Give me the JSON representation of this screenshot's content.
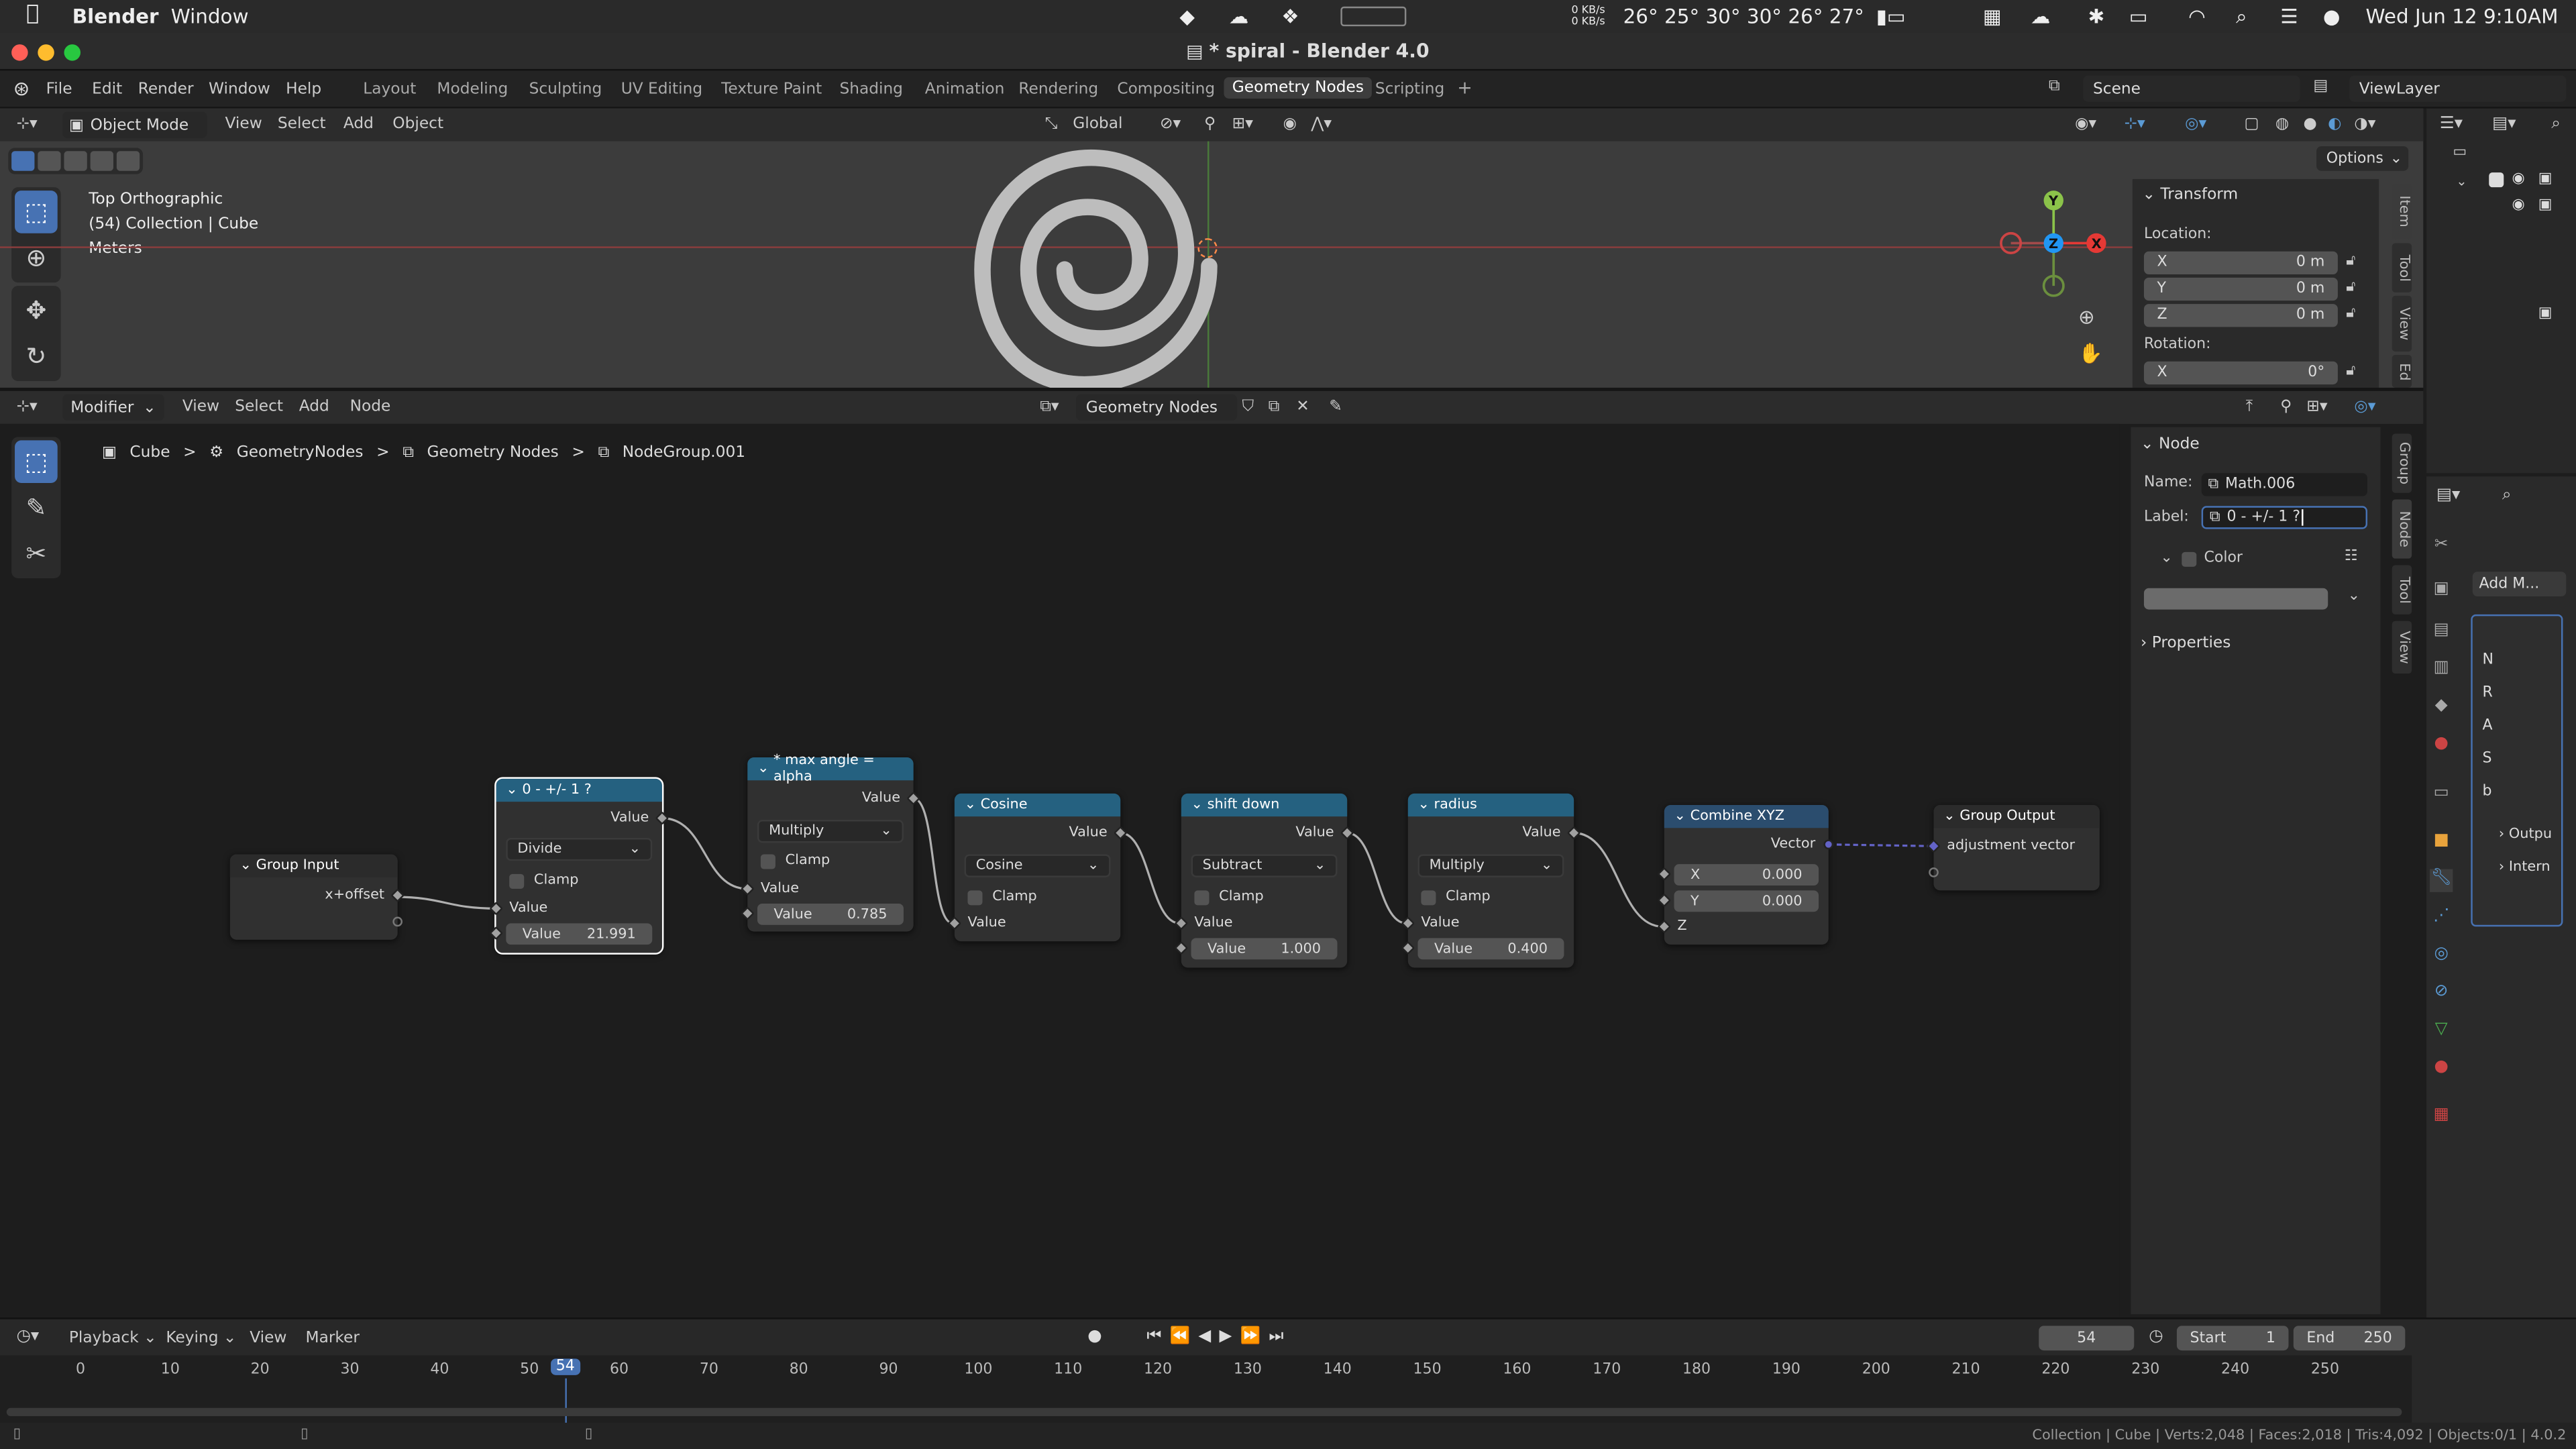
{
  "macos": {
    "apple_icon": "apple-logo",
    "app_name": "Blender",
    "menu": [
      "Window"
    ],
    "net_up": "0 KB/s",
    "net_down": "0 KB/s",
    "temps": "26° 25° 30° 30° 26° 27°",
    "datetime": "Wed Jun 12  9:10AM"
  },
  "window": {
    "title": "* spiral - Blender 4.0"
  },
  "topbar": {
    "menus": [
      "File",
      "Edit",
      "Render",
      "Window",
      "Help"
    ],
    "workspaces": [
      "Layout",
      "Modeling",
      "Sculpting",
      "UV Editing",
      "Texture Paint",
      "Shading",
      "Animation",
      "Rendering",
      "Compositing",
      "Geometry Nodes",
      "Scripting"
    ],
    "active_workspace": "Geometry Nodes",
    "add_tab": "+",
    "scene": "Scene",
    "view_layer": "ViewLayer"
  },
  "viewport": {
    "mode": "Object Mode",
    "menus": [
      "View",
      "Select",
      "Add",
      "Object"
    ],
    "orientation": "Global",
    "options": "Options",
    "overlay_lines": [
      "Top Orthographic",
      "(54) Collection | Cube",
      "Meters"
    ],
    "gizmo": {
      "y": "Y",
      "z": "Z",
      "x": "X"
    },
    "transform_panel": {
      "title": "Transform",
      "location_label": "Location:",
      "x_label": "X",
      "x": "0 m",
      "y_label": "Y",
      "y": "0 m",
      "z_label": "Z",
      "z": "0 m",
      "rotation_label": "Rotation:",
      "rx_label": "X",
      "rx": "0°"
    },
    "side_tabs": [
      "Item",
      "Tool",
      "View",
      "Ed"
    ]
  },
  "node_editor": {
    "editor_type": "Modifier",
    "menus": [
      "View",
      "Select",
      "Add",
      "Node"
    ],
    "node_tree": "Geometry Nodes",
    "breadcrumb": [
      "Cube",
      "GeometryNodes",
      "Geometry Nodes",
      "NodeGroup.001"
    ],
    "breadcrumb_sep": ">",
    "side_tabs": [
      "Group",
      "Node",
      "Tool",
      "View"
    ],
    "node_panel": {
      "title": "Node",
      "name_label": "Name:",
      "name": "Math.006",
      "label_label": "Label:",
      "label": "0 - +/- 1 ?",
      "color_label": "Color",
      "properties_label": "Properties"
    },
    "nodes": {
      "group_input": {
        "title": "Group Input",
        "output": "x+offset"
      },
      "divide": {
        "title": "0 - +/- 1 ?",
        "output": "Value",
        "operation": "Divide",
        "clamp": "Clamp",
        "input": "Value",
        "value_label": "Value",
        "value": "21.991"
      },
      "max_angle": {
        "title": "* max angle = alpha",
        "output": "Value",
        "operation": "Multiply",
        "clamp": "Clamp",
        "input": "Value",
        "value_label": "Value",
        "value": "0.785"
      },
      "cosine": {
        "title": "Cosine",
        "output": "Value",
        "operation": "Cosine",
        "clamp": "Clamp",
        "input": "Value"
      },
      "shift_down": {
        "title": "shift down",
        "output": "Value",
        "operation": "Subtract",
        "clamp": "Clamp",
        "input": "Value",
        "value_label": "Value",
        "value": "1.000"
      },
      "radius": {
        "title": "radius",
        "output": "Value",
        "operation": "Multiply",
        "clamp": "Clamp",
        "input": "Value",
        "value_label": "Value",
        "value": "0.400"
      },
      "combine_xyz": {
        "title": "Combine XYZ",
        "output": "Vector",
        "x_label": "X",
        "x": "0.000",
        "y_label": "Y",
        "y": "0.000",
        "z_label": "Z"
      },
      "group_output": {
        "title": "Group Output",
        "input": "adjustment vector"
      }
    }
  },
  "properties_panel": {
    "add_modifier": "Add M...",
    "rows": [
      "N",
      "R",
      "A",
      "S",
      "b"
    ],
    "sub": [
      "Outpu",
      "Intern"
    ]
  },
  "timeline": {
    "menus": [
      "Playback",
      "Keying",
      "View",
      "Marker"
    ],
    "current_frame": "54",
    "start_label": "Start",
    "start": "1",
    "end_label": "End",
    "end": "250",
    "ticks": [
      "0",
      "10",
      "20",
      "30",
      "40",
      "50",
      "60",
      "70",
      "80",
      "90",
      "100",
      "110",
      "120",
      "130",
      "140",
      "150",
      "160",
      "170",
      "180",
      "190",
      "200",
      "210",
      "220",
      "230",
      "240",
      "250"
    ]
  },
  "status_bar": {
    "text": "Collection | Cube | Verts:2,048 | Faces:2,018 | Tris:4,092 | Objects:0/1 | 4.0.2"
  },
  "colors": {
    "accent": "#4772b3",
    "node_header_math": "#256180",
    "selection_outline": "#ffffff",
    "vector_socket": "#6363c7"
  }
}
